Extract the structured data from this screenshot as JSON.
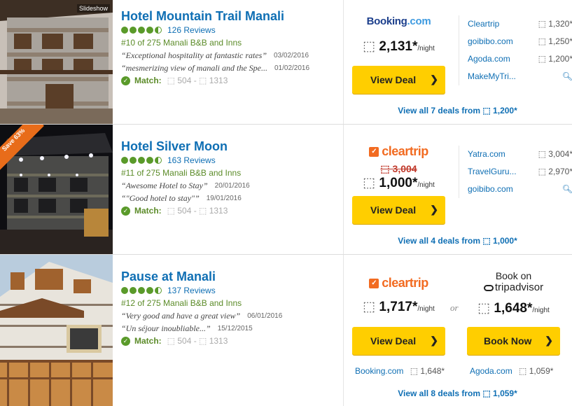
{
  "listings": [
    {
      "name": "Hotel Mountain Trail Manali",
      "photo_label": "Slideshow",
      "reviews": "126 Reviews",
      "rank": "#10 of 275 Manali B&B and Inns",
      "quotes": [
        {
          "text": "“Exceptional hospitality at fantastic rates”",
          "date": "03/02/2016"
        },
        {
          "text": "“mesmerizing view of manali and the Spe...",
          "date": "01/02/2016"
        }
      ],
      "match_label": "Match:",
      "match_value": "⬚ 504 - ⬚ 1313",
      "provider": "Booking.com",
      "currency": "⬚",
      "price": "2,131*",
      "unit": "/night",
      "button": "View Deal",
      "alts": [
        {
          "name": "Cleartrip",
          "price": "⬚ 1,320*"
        },
        {
          "name": "goibibo.com",
          "price": "⬚ 1,250*"
        },
        {
          "name": "Agoda.com",
          "price": "⬚ 1,200*"
        },
        {
          "name": "MakeMyTri...",
          "price": ""
        }
      ],
      "view_all": "View all 7 deals from ⬚ 1,200*"
    },
    {
      "name": "Hotel Silver Moon",
      "badge": "Save 63%",
      "reviews": "163 Reviews",
      "rank": "#11 of 275 Manali B&B and Inns",
      "quotes": [
        {
          "text": "“Awesome Hotel to Stay”",
          "date": "20/01/2016"
        },
        {
          "text": "“\"Good hotel to stay\"”",
          "date": "19/01/2016"
        }
      ],
      "match_label": "Match:",
      "match_value": "⬚ 504 - ⬚ 1313",
      "provider": "cleartrip",
      "old_price": "⬚ 3,004",
      "currency": "⬚",
      "price": "1,000*",
      "unit": "/night",
      "button": "View Deal",
      "alts": [
        {
          "name": "Yatra.com",
          "price": "⬚ 3,004*"
        },
        {
          "name": "TravelGuru...",
          "price": "⬚ 2,970*"
        },
        {
          "name": "goibibo.com",
          "price": ""
        }
      ],
      "view_all": "View all 4 deals from ⬚ 1,000*"
    },
    {
      "name": "Pause at Manali",
      "reviews": "137 Reviews",
      "rank": "#12 of 275 Manali B&B and Inns",
      "quotes": [
        {
          "text": "“Very good and have a great view”",
          "date": "06/01/2016"
        },
        {
          "text": "“Un séjour inoubliable...”",
          "date": "15/12/2015"
        }
      ],
      "match_label": "Match:",
      "match_value": "⬚ 504 - ⬚ 1313",
      "provider": "cleartrip",
      "currency": "⬚",
      "price": "1,717*",
      "unit": "/night",
      "button": "View Deal",
      "or_text": "or",
      "book_on": "Book on",
      "ta_brand": "tripadvisor",
      "ta_price": "1,648*",
      "ta_button": "Book Now",
      "sub_deals": [
        {
          "name": "Booking.com",
          "price": "⬚ 1,648*"
        },
        {
          "name": "Agoda.com",
          "price": "⬚ 1,059*"
        }
      ],
      "view_all": "View all 8 deals from ⬚ 1,059*"
    }
  ],
  "colors": {
    "link": "#0f6fb4",
    "green": "#5a9a2a",
    "button": "#ffce00",
    "cleartrip": "#f26b21",
    "strike": "#c0392b"
  },
  "icons": {
    "rating": "bubble-rating-icon",
    "check": "check-circle-icon",
    "arrow": "chevron-right-icon",
    "search": "magnifier-icon"
  }
}
